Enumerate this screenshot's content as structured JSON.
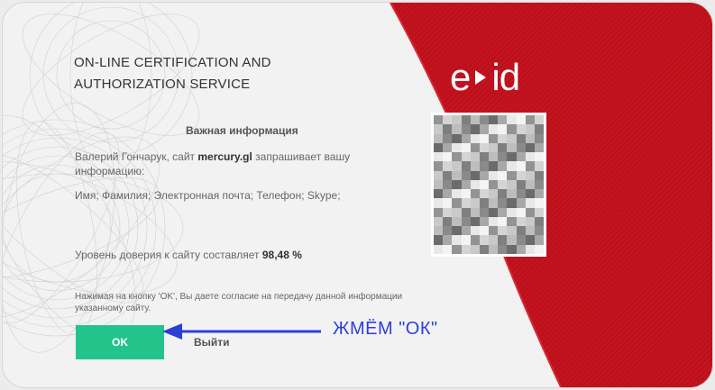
{
  "header": {
    "title_line1": "ON-LINE CERTIFICATION AND",
    "title_line2": "AUTHORIZATION SERVICE"
  },
  "logo": {
    "left": "e",
    "right": "id"
  },
  "info": {
    "heading": "Важная информация",
    "request_prefix": "Валерий Гончарук, сайт ",
    "site": "mercury.gl",
    "request_suffix": " запрашивает вашу информацию:",
    "fields": "Имя; Фамилия; Электронная почта; Телефон; Skype;",
    "trust_prefix": "Уровень доверия к сайту составляет ",
    "trust_value": "98,48 %",
    "consent": "Нажимая на кнопку 'OK', Вы даете согласие на передачу данной информации указанному сайту."
  },
  "buttons": {
    "ok_label": "OK",
    "exit_label": "Выйти"
  },
  "annotation": {
    "text": "ЖМЁМ \"ОК\"",
    "color": "#2d3fd8"
  },
  "colors": {
    "red": "#c4131f",
    "ok_green": "#23c38c",
    "card_bg": "#f2f2f2"
  }
}
